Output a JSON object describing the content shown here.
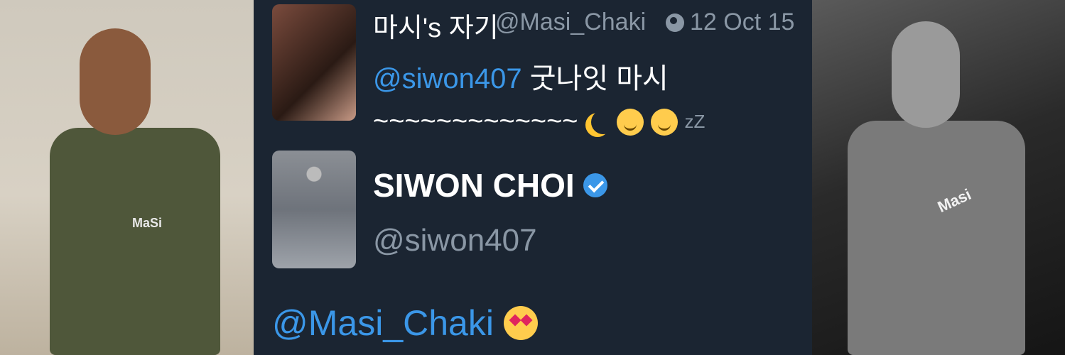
{
  "tweet1": {
    "display_name": "마시's 자기",
    "handle": "@Masi_Chaki",
    "timestamp": "12 Oct 15",
    "mention": "@siwon407",
    "text": " 굿나잇 마시",
    "tilde_line": "~~~~~~~~~~~~~",
    "zz": "zZ"
  },
  "tweet2": {
    "display_name": "SIWON CHOI",
    "handle": "@siwon407",
    "reply_mention": "@Masi_Chaki"
  },
  "shirt": {
    "left_logo": "MaSi",
    "right_logo": "Masi"
  },
  "icons": [
    "globe-icon",
    "moon-icon",
    "relieved-face-icon",
    "sleeping-face-icon",
    "verified-icon",
    "heart-eyes-icon"
  ],
  "colors": {
    "background": "#1b2532",
    "mention": "#3b97e8",
    "muted": "#8a97a5",
    "verified": "#3b97e8"
  }
}
